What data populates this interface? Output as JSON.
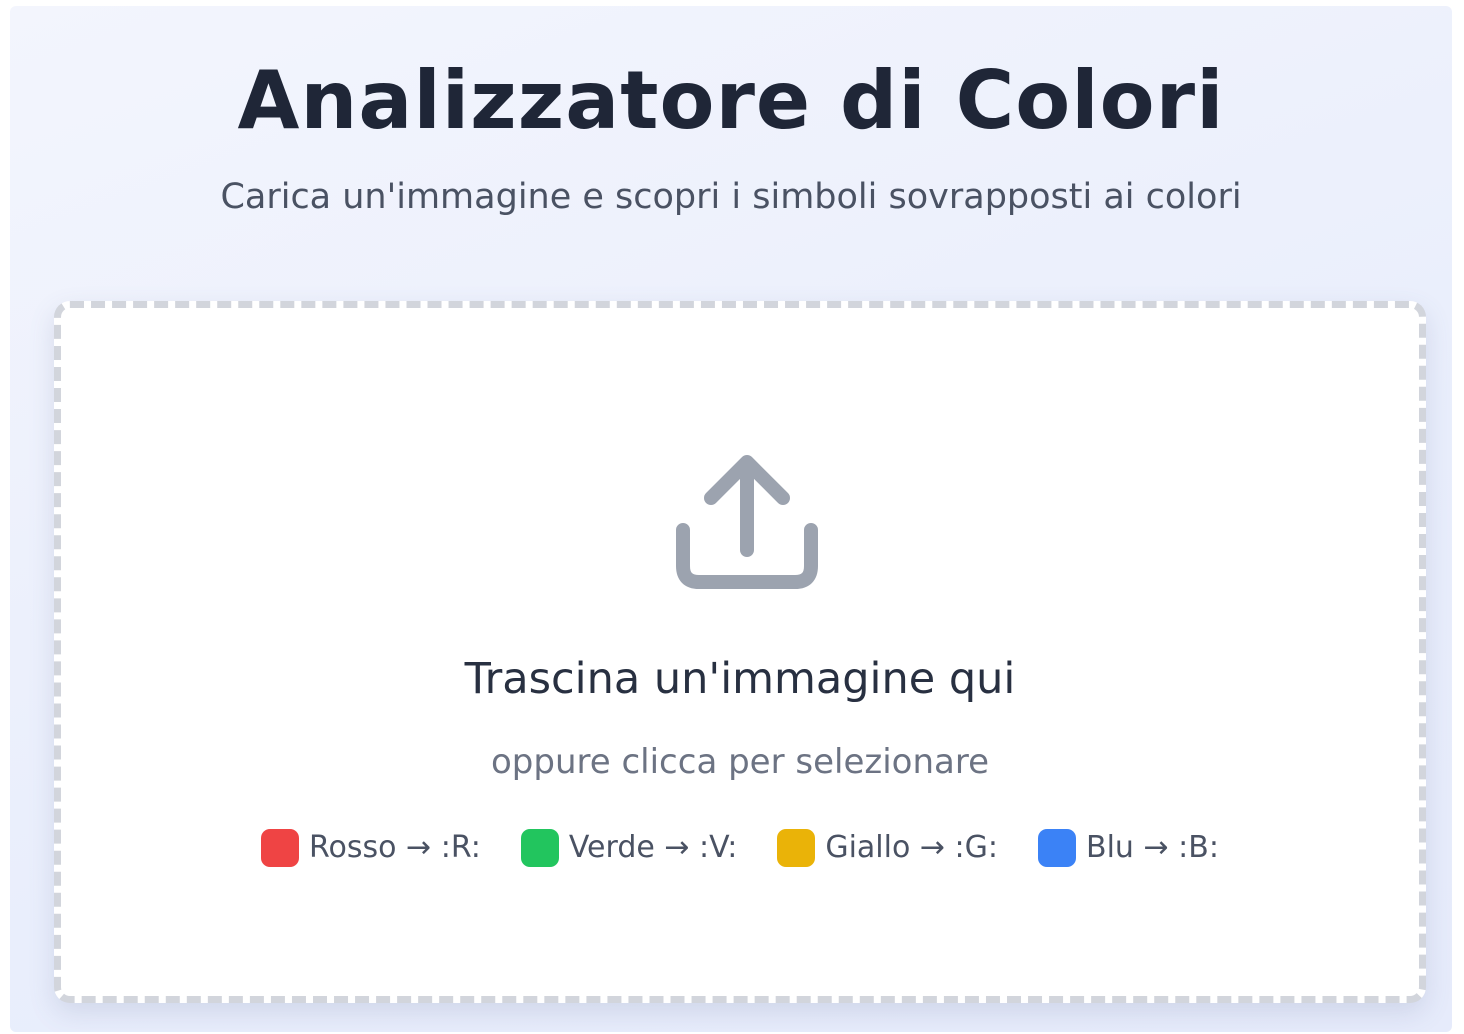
{
  "header": {
    "title": "Analizzatore di Colori",
    "subtitle": "Carica un'immagine e scopri i simboli sovrapposti ai colori"
  },
  "dropzone": {
    "icon": "upload-icon",
    "title": "Trascina un'immagine qui",
    "hint": "oppure clicca per selezionare",
    "legend": [
      {
        "label": "Rosso → :R:",
        "color": "#ef4444"
      },
      {
        "label": "Verde → :V:",
        "color": "#22c55e"
      },
      {
        "label": "Giallo → :G:",
        "color": "#eab308"
      },
      {
        "label": "Blu → :B:",
        "color": "#3b82f6"
      }
    ]
  },
  "colors": {
    "title": "#1f2637",
    "dropzone_border": "#d2d5dc",
    "icon": "#9ca3af"
  }
}
